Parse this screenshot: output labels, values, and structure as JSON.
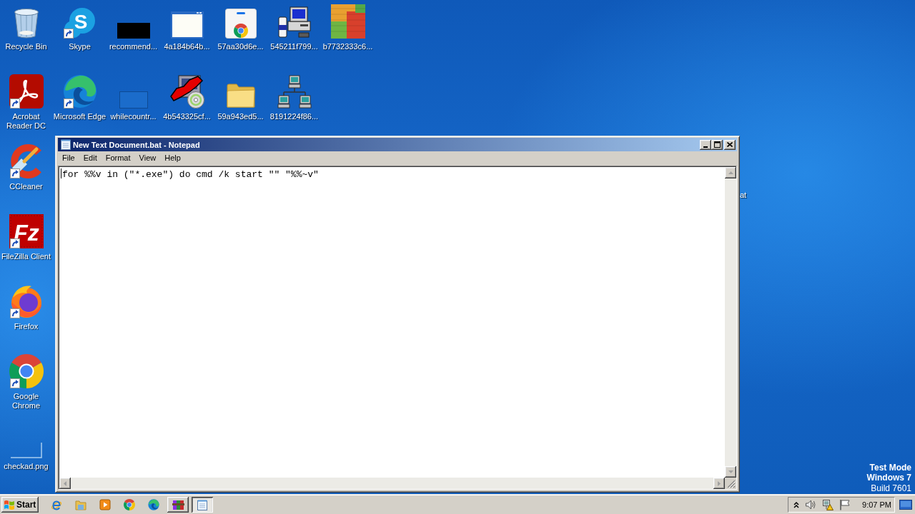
{
  "desktop": {
    "columns": [
      [
        {
          "label": "Recycle Bin",
          "kind": "trash",
          "shortcut": false
        },
        {
          "label": "Acrobat Reader DC",
          "kind": "document",
          "shortcut": true
        },
        {
          "label": "CCleaner",
          "kind": "brush",
          "shortcut": true
        },
        {
          "label": "FileZilla Client",
          "kind": "fz",
          "logo_text": "Fz",
          "shortcut": true
        },
        {
          "label": "Firefox",
          "kind": "fox",
          "shortcut": true
        },
        {
          "label": "Google Chrome",
          "kind": "globe",
          "shortcut": true
        },
        {
          "label": "checkad.png",
          "kind": "image",
          "shortcut": false
        }
      ],
      [
        {
          "label": "Skype",
          "kind": "chat",
          "logo_text": "S",
          "shortcut": true
        },
        {
          "label": "Microsoft Edge",
          "kind": "swirl",
          "shortcut": true
        }
      ],
      [
        {
          "label": "recommend...",
          "kind": "console",
          "shortcut": false
        },
        {
          "label": "whilecountr...",
          "kind": "thumbnail",
          "shortcut": false
        }
      ],
      [
        {
          "label": "4a184b64b...",
          "kind": "window",
          "shortcut": false
        },
        {
          "label": "4b543325cf...",
          "kind": "installer",
          "shortcut": false
        }
      ],
      [
        {
          "label": "57aa30d6e...",
          "kind": "bag",
          "shortcut": false
        },
        {
          "label": "59a943ed5...",
          "kind": "folder",
          "shortcut": false
        }
      ],
      [
        {
          "label": "545211f799...",
          "kind": "computer",
          "shortcut": false
        },
        {
          "label": "8191224f86...",
          "kind": "network",
          "shortcut": false
        }
      ],
      [
        {
          "label": "b7732333c6...",
          "kind": "tiles",
          "shortcut": false
        }
      ]
    ],
    "covered_icon_label": "at",
    "edition": {
      "mode": "Test Mode",
      "os": "Windows 7",
      "build": "Build 7601"
    }
  },
  "window": {
    "title": "New Text Document.bat - Notepad",
    "active": true,
    "menu": [
      "File",
      "Edit",
      "Format",
      "View",
      "Help"
    ],
    "text": "for %%v in (\"*.exe\") do cmd /k start \"\" \"%%~v\""
  },
  "taskbar": {
    "start": "Start",
    "tasks": [
      {
        "kind": "archive",
        "selected": false
      },
      {
        "kind": "notepad",
        "selected": true
      }
    ],
    "clock": "9:07 PM"
  }
}
